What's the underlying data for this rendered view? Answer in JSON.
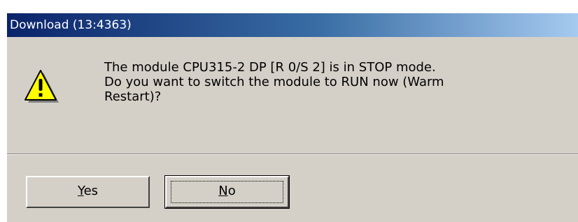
{
  "window": {
    "title": "Download (13:4363)"
  },
  "dialog": {
    "icon": "warning-icon",
    "message_lines": [
      "The module CPU315-2 DP [R 0/S 2] is in STOP mode.",
      "Do you want to switch the module to RUN now (Warm",
      "Restart)?"
    ]
  },
  "buttons": {
    "yes": {
      "accel": "Y",
      "rest": "es"
    },
    "no": {
      "accel": "N",
      "rest": "o"
    }
  },
  "colors": {
    "titlebar_start": "#0a246a",
    "titlebar_end": "#a6caf0",
    "face": "#d4d0c8",
    "warning_yellow": "#ffff00"
  }
}
